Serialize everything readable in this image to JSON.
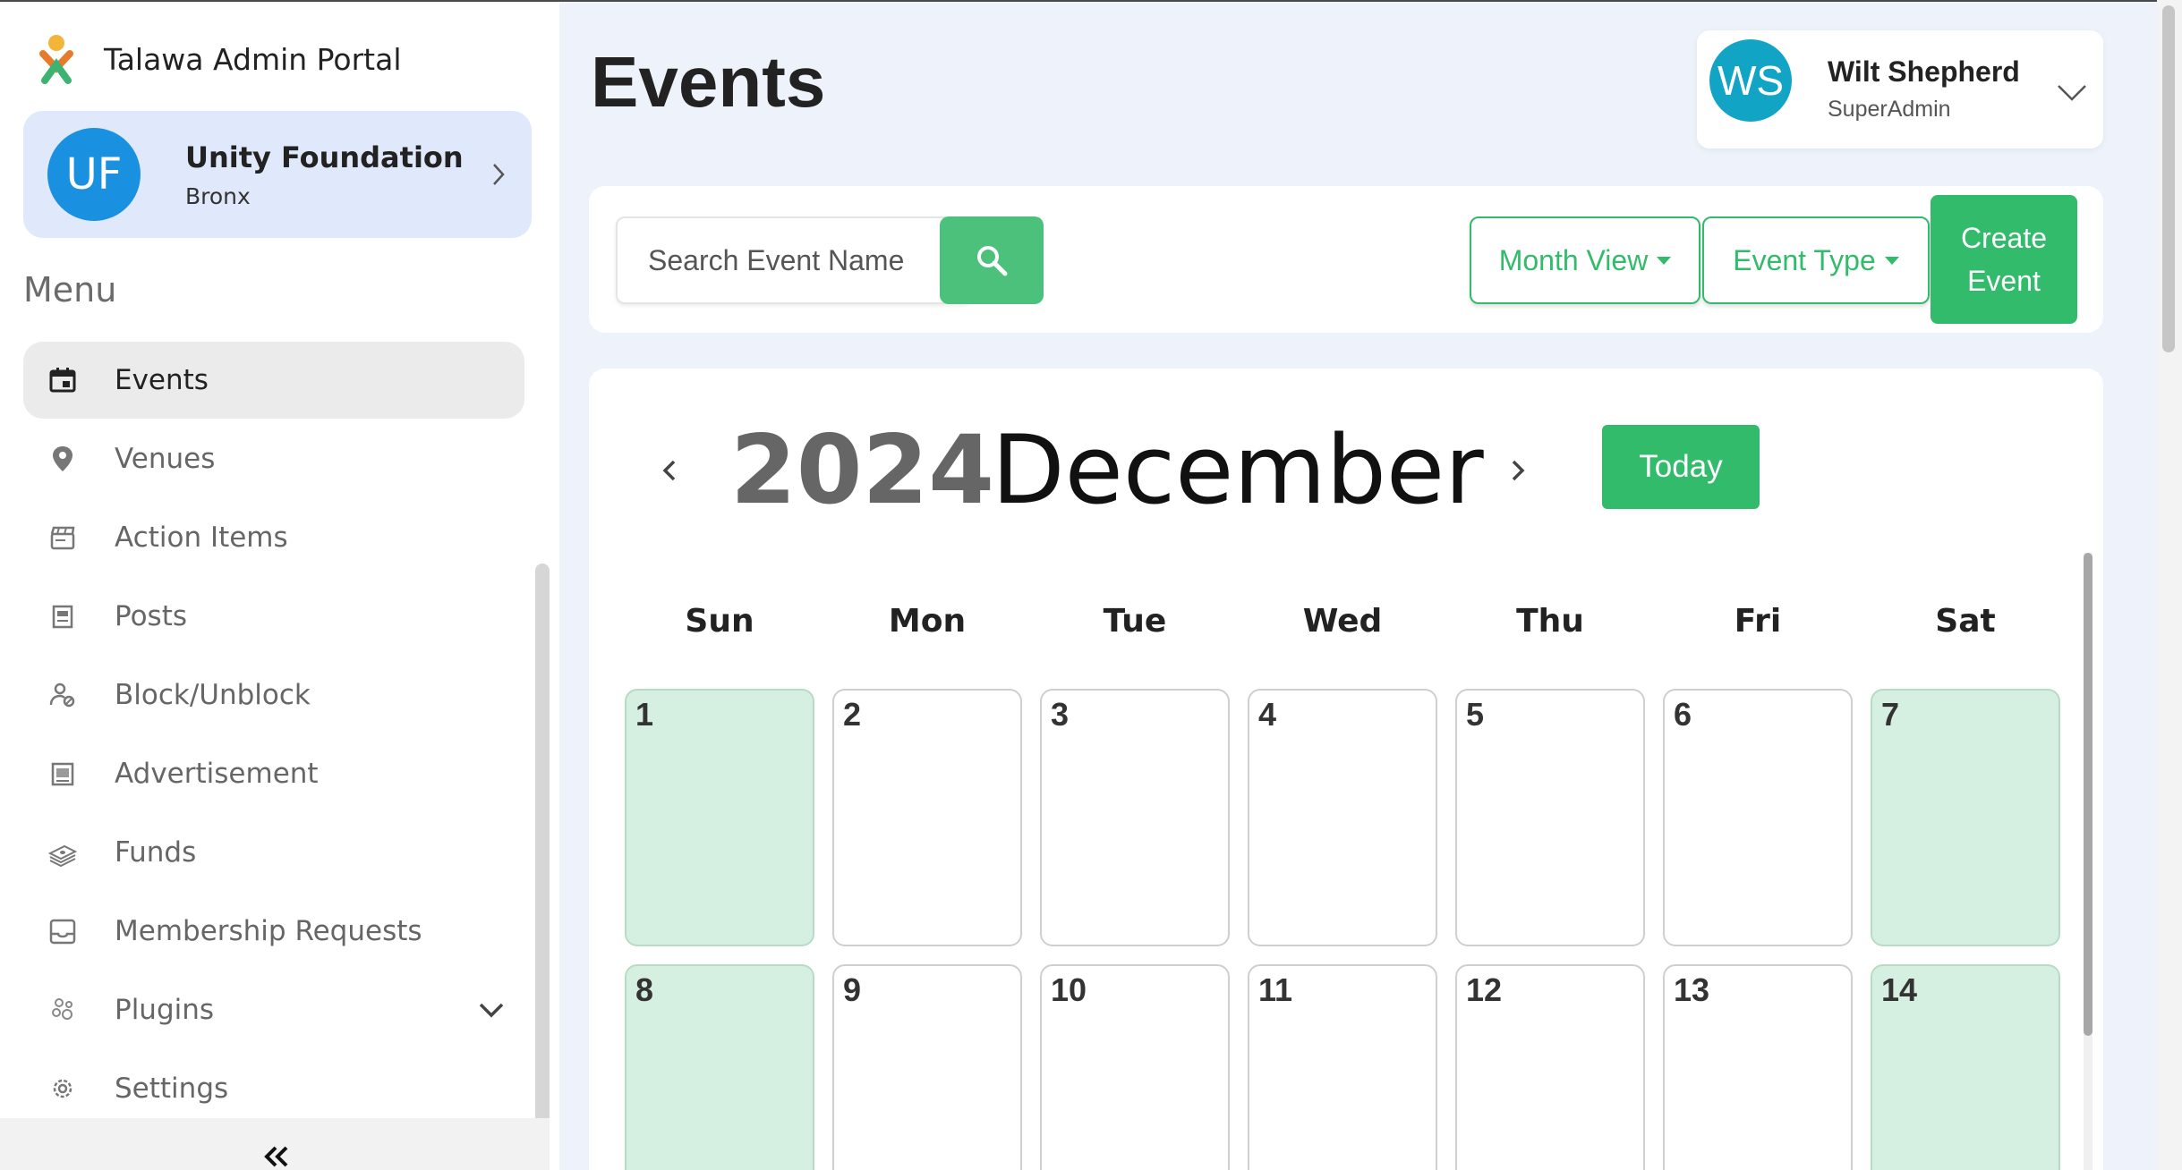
{
  "app": {
    "title": "Talawa Admin Portal"
  },
  "organization": {
    "initials": "UF",
    "name": "Unity Foundation",
    "location": "Bronx",
    "avatar_color": "#1a90e0"
  },
  "sidebar": {
    "menu_title": "Menu",
    "items": [
      {
        "label": "Events",
        "icon": "calendar-icon",
        "active": true
      },
      {
        "label": "Venues",
        "icon": "location-pin-icon"
      },
      {
        "label": "Action Items",
        "icon": "clapperboard-icon"
      },
      {
        "label": "Posts",
        "icon": "document-icon"
      },
      {
        "label": "Block/Unblock",
        "icon": "user-block-icon"
      },
      {
        "label": "Advertisement",
        "icon": "advertisement-icon"
      },
      {
        "label": "Funds",
        "icon": "money-stack-icon"
      },
      {
        "label": "Membership Requests",
        "icon": "inbox-icon"
      },
      {
        "label": "Plugins",
        "icon": "plugin-icon",
        "has_dropdown": true
      },
      {
        "label": "Settings",
        "icon": "gear-icon"
      }
    ],
    "collapse_icon": "double-chevron-left-icon"
  },
  "header": {
    "page_title": "Events"
  },
  "user": {
    "initials": "WS",
    "name": "Wilt Shepherd",
    "role": "SuperAdmin",
    "avatar_color": "#11a4c4"
  },
  "toolbar": {
    "search_placeholder": "Search Event Name",
    "view_dropdown": "Month View",
    "type_dropdown": "Event Type",
    "create_label_line1": "Create",
    "create_label_line2": "Event",
    "accent_color": "#31bb6b"
  },
  "calendar": {
    "year": "2024",
    "month": "December",
    "today_label": "Today",
    "weekdays": [
      "Sun",
      "Mon",
      "Tue",
      "Wed",
      "Thu",
      "Fri",
      "Sat"
    ],
    "weeks": [
      [
        "1",
        "2",
        "3",
        "4",
        "5",
        "6",
        "7"
      ],
      [
        "8",
        "9",
        "10",
        "11",
        "12",
        "13",
        "14"
      ]
    ],
    "weekend_color": "#d5efe0"
  }
}
